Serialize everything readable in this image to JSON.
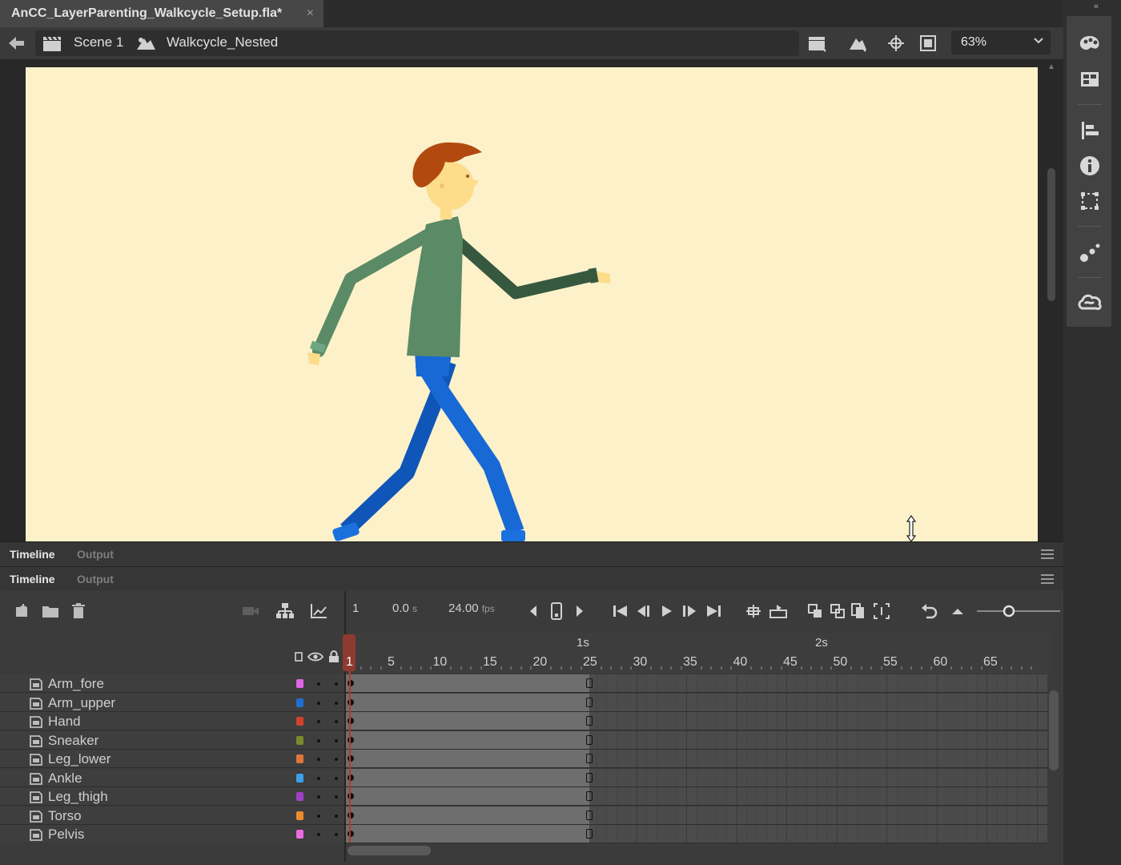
{
  "document": {
    "tab_title": "AnCC_LayerParenting_Walkcycle_Setup.fla*",
    "close_glyph": "×"
  },
  "editbar": {
    "scene_label": "Scene 1",
    "symbol_label": "Walkcycle_Nested",
    "zoom": "63%"
  },
  "panels": {
    "top": {
      "tabs": [
        "Timeline",
        "Output"
      ]
    },
    "main": {
      "tabs": [
        "Timeline",
        "Output"
      ]
    }
  },
  "timeline": {
    "current_frame": "1",
    "time_value": "0.0",
    "time_unit": "s",
    "fps_value": "24.00",
    "fps_unit": "fps",
    "ruler_numbers": [
      "5",
      "10",
      "15",
      "20",
      "25",
      "30",
      "35",
      "40",
      "45",
      "50",
      "55",
      "60",
      "65"
    ],
    "ruler_seconds": [
      "1s",
      "2s"
    ],
    "playhead_label": "1",
    "layers": [
      {
        "name": "Arm_fore",
        "color": "#e063e8"
      },
      {
        "name": "Arm_upper",
        "color": "#1f6fd0"
      },
      {
        "name": "Hand",
        "color": "#d2422e"
      },
      {
        "name": "Sneaker",
        "color": "#7a8a2a"
      },
      {
        "name": "Leg_lower",
        "color": "#e0773a"
      },
      {
        "name": "Ankle",
        "color": "#3aa0ee"
      },
      {
        "name": "Leg_thigh",
        "color": "#a040c8"
      },
      {
        "name": "Torso",
        "color": "#f08a2a"
      },
      {
        "name": "Pelvis",
        "color": "#e86be0"
      }
    ]
  },
  "colors": {
    "stage_bg": "#fcf1c9",
    "hair": "#b24a10",
    "skin": "#fddc8a",
    "shirt": "#5b8a66",
    "shirt_dark": "#36583f",
    "pants": "#1868d6",
    "pants_dark": "#0f56b8"
  }
}
